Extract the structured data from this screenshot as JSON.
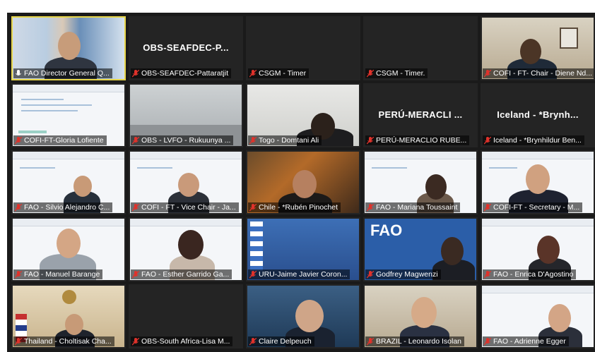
{
  "meeting": {
    "tiles": [
      {
        "label": "FAO Director General Q...",
        "video": "person",
        "mic": "on"
      },
      {
        "label": "OBS-SEAFDEC-Pattaratjit",
        "video": "off",
        "display_name": "OBS-SEAFDEC-P...",
        "mic": "muted"
      },
      {
        "label": "CSGM - Timer",
        "video": "off",
        "mic": "muted"
      },
      {
        "label": "CSGM - Timer.",
        "video": "off",
        "mic": "muted"
      },
      {
        "label": "COFI - FT- Chair - Diene Nd...",
        "video": "person",
        "mic": "muted"
      },
      {
        "label": "COFI-FT-Gloria Lofiente",
        "video": "slide",
        "mic": "muted"
      },
      {
        "label": "OBS - LVFO - Rukuunya ...",
        "video": "room",
        "mic": "muted"
      },
      {
        "label": "Togo - Domtani Ali",
        "video": "person",
        "mic": "muted"
      },
      {
        "label": "PERÚ-MERACLIO RUBE...",
        "video": "off",
        "display_name": "PERÚ-MERACLI ...",
        "mic": "muted"
      },
      {
        "label": "Iceland - *Brynhildur Ben...",
        "video": "off",
        "display_name": "Iceland - *Brynh...",
        "mic": "muted"
      },
      {
        "label": "FAO - Silvio Alejandro C...",
        "video": "slide-person",
        "mic": "muted"
      },
      {
        "label": "COFI - FT - Vice Chair - Ja...",
        "video": "slide-person",
        "mic": "muted"
      },
      {
        "label": "Chile - *Rubén Pinochet",
        "video": "person",
        "mic": "muted"
      },
      {
        "label": "FAO - Mariana Toussaint",
        "video": "slide-person",
        "mic": "muted"
      },
      {
        "label": "COFI-FT - Secretary - M...",
        "video": "slide-person",
        "mic": "muted"
      },
      {
        "label": "FAO - Manuel Barange",
        "video": "slide-person",
        "mic": "muted"
      },
      {
        "label": "FAO - Esther Garrido Ga...",
        "video": "slide-person",
        "mic": "muted"
      },
      {
        "label": "URU-Jaime Javier Coron...",
        "video": "flag",
        "mic": "muted"
      },
      {
        "label": "Godfrey Magwenzi",
        "video": "fao",
        "fao_text": "FAO",
        "mic": "muted"
      },
      {
        "label": "FAO - Enrica D'Agostino",
        "video": "slide-person",
        "mic": "muted"
      },
      {
        "label": "Thailand - Choltisak Cha...",
        "video": "person",
        "mic": "muted"
      },
      {
        "label": "OBS-South Africa-Lisa M...",
        "video": "off",
        "mic": "muted"
      },
      {
        "label": "Claire Delpeuch",
        "video": "person",
        "mic": "muted"
      },
      {
        "label": "BRAZIL - Leonardo Isolan",
        "video": "person",
        "mic": "muted"
      },
      {
        "label": "FAO - Adrienne Egger",
        "video": "slide-person",
        "mic": "muted"
      }
    ]
  },
  "colors": {
    "active_speaker_border": "#e7d64a",
    "muted_icon": "#e0322b",
    "label_text": "#ffffff",
    "off_tile_bg": "#242424",
    "fao_blue": "#2b5ea8"
  },
  "icons": {
    "mic_on": "microphone-icon",
    "mic_muted": "microphone-muted-icon"
  }
}
